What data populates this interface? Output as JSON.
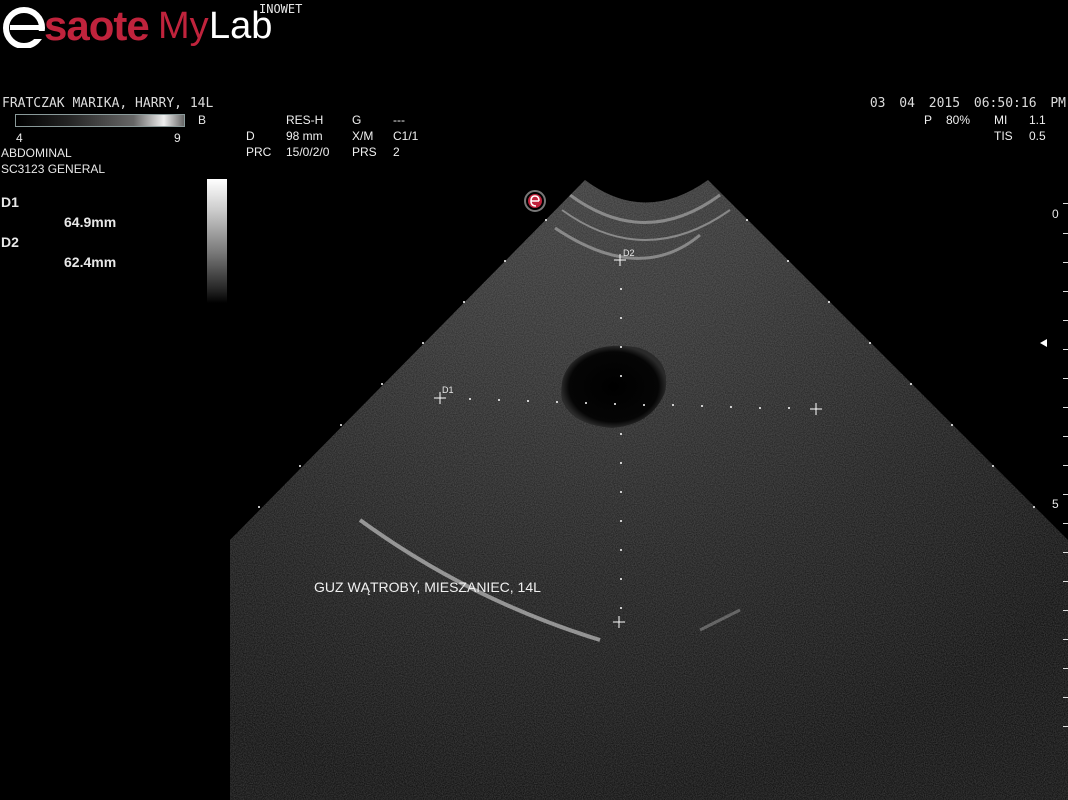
{
  "header": {
    "logo_text": "esaote MyLab",
    "site": "INOWET",
    "patient": "FRATCZAK MARIKA, HARRY, 14L",
    "datetime": "03  04  2015 06:50:16 PM"
  },
  "grayscale_bar": {
    "min_label": "4",
    "max_label": "9",
    "mode": "B"
  },
  "exam": {
    "preset": "ABDOMINAL",
    "probe": "SC3123  GENERAL"
  },
  "params": {
    "res_label": "RES-H",
    "g_label": "G",
    "g_value": "---",
    "d_label": "D",
    "d_value": "98 mm",
    "xm_label": "X/M",
    "xm_value": "C1/1",
    "prc_label": "PRC",
    "prc_value": "15/0/2/0",
    "prs_label": "PRS",
    "prs_value": "2",
    "p_label": "P",
    "p_value": "80%",
    "mi_label": "MI",
    "mi_value": "1.1",
    "tis_label": "TIS",
    "tis_value": "0.5"
  },
  "measurements": [
    {
      "label": "D1",
      "value": "64.9mm"
    },
    {
      "label": "D2",
      "value": "62.4mm"
    }
  ],
  "annotation": "GUZ WĄTROBY, MIESZANIEC, 14L",
  "depth_scale": {
    "top_label": "0",
    "mid_label": "5"
  },
  "calipers": {
    "d1_label": "D1",
    "d2_label": "D2"
  },
  "colors": {
    "brand": "#c0233c",
    "background": "#000000",
    "text": "#e8e8e8"
  }
}
